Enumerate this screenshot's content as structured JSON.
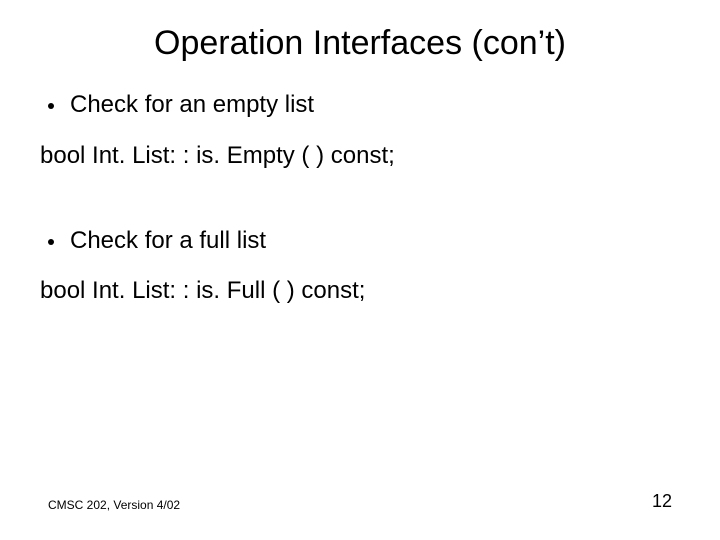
{
  "title": "Operation Interfaces (con’t)",
  "bullets": {
    "b1": "Check for an empty list",
    "b2": "Check for a full list"
  },
  "code": {
    "c1": "bool Int. List: : is. Empty ( ) const;",
    "c2": "bool Int. List: : is. Full ( ) const;"
  },
  "footer": {
    "left": "CMSC 202, Version 4/02",
    "page": "12"
  }
}
